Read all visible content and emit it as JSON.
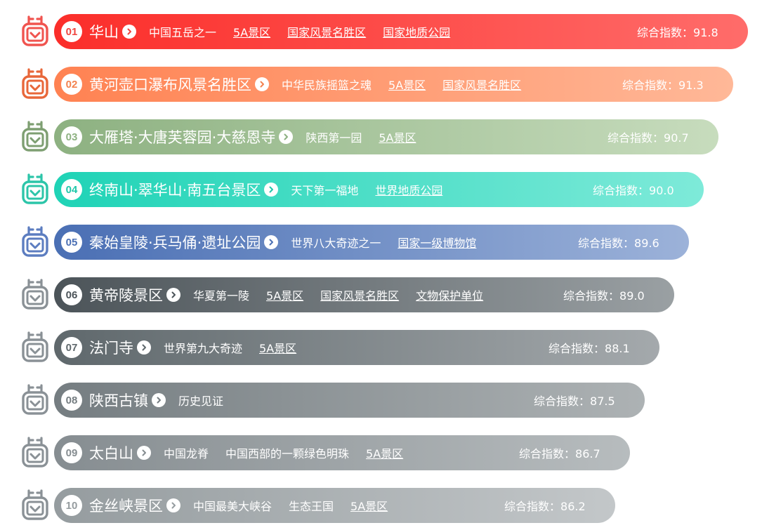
{
  "score_label": "综合指数：",
  "items": [
    {
      "rank": "01",
      "name": "华山",
      "score": "91.8",
      "tags": [
        {
          "text": "中国五岳之一",
          "link": false
        },
        {
          "text": "5A景区",
          "link": true
        },
        {
          "text": "国家风景名胜区",
          "link": true
        },
        {
          "text": "国家地质公园",
          "link": true
        }
      ],
      "colors": [
        "#fb2e2a",
        "#ff6c6a"
      ],
      "icon_color": "#f0544f",
      "rank_color": "#f0443f"
    },
    {
      "rank": "02",
      "name": "黄河壶口瀑布风景名胜区",
      "score": "91.3",
      "tags": [
        {
          "text": "中华民族摇篮之魂",
          "link": false
        },
        {
          "text": "5A景区",
          "link": true
        },
        {
          "text": "国家风景名胜区",
          "link": true
        }
      ],
      "colors": [
        "#ff8252",
        "#ffb898"
      ],
      "icon_color": "#e8673a",
      "rank_color": "#f3824f"
    },
    {
      "rank": "03",
      "name": "大雁塔·大唐芙蓉园·大慈恩寺",
      "score": "90.7",
      "tags": [
        {
          "text": "陕西第一园",
          "link": false
        },
        {
          "text": "5A景区",
          "link": true
        }
      ],
      "colors": [
        "#8db181",
        "#c7dcbd"
      ],
      "icon_color": "#7e9f72",
      "rank_color": "#8db181"
    },
    {
      "rank": "04",
      "name": "终南山·翠华山·南五台景区",
      "score": "90.0",
      "tags": [
        {
          "text": "天下第一福地",
          "link": false
        },
        {
          "text": "世界地质公园",
          "link": true
        }
      ],
      "colors": [
        "#1fd3b6",
        "#7eead9"
      ],
      "icon_color": "#2cc5a9",
      "rank_color": "#1fc7aa"
    },
    {
      "rank": "05",
      "name": "秦始皇陵·兵马俑·遗址公园",
      "score": "89.6",
      "tags": [
        {
          "text": "世界八大奇迹之一",
          "link": false
        },
        {
          "text": "国家一级博物馆",
          "link": true
        }
      ],
      "colors": [
        "#4a6fb4",
        "#9cb2d9"
      ],
      "icon_color": "#5c7dc0",
      "rank_color": "#4a6fb4"
    },
    {
      "rank": "06",
      "name": "黄帝陵景区",
      "score": "89.0",
      "tags": [
        {
          "text": "华夏第一陵",
          "link": false
        },
        {
          "text": "5A景区",
          "link": true
        },
        {
          "text": "国家风景名胜区",
          "link": true
        },
        {
          "text": "文物保护单位",
          "link": true
        }
      ],
      "colors": [
        "#4c5459",
        "#9aa0a3"
      ],
      "icon_color": "#8a9196",
      "rank_color": "#4c5459"
    },
    {
      "rank": "07",
      "name": "法门寺",
      "score": "88.1",
      "tags": [
        {
          "text": "世界第九大奇迹",
          "link": false
        },
        {
          "text": "5A景区",
          "link": true
        }
      ],
      "colors": [
        "#5f686c",
        "#a4a9ac"
      ],
      "icon_color": "#8a9196",
      "rank_color": "#5f686c"
    },
    {
      "rank": "08",
      "name": "陕西古镇",
      "score": "87.5",
      "tags": [
        {
          "text": "历史见证",
          "link": false
        }
      ],
      "colors": [
        "#757d81",
        "#adb2b4"
      ],
      "icon_color": "#8a9196",
      "rank_color": "#757d81"
    },
    {
      "rank": "09",
      "name": "太白山",
      "score": "86.7",
      "tags": [
        {
          "text": "中国龙脊",
          "link": false
        },
        {
          "text": "中国西部的一颗绿色明珠",
          "link": false
        },
        {
          "text": "5A景区",
          "link": true
        }
      ],
      "colors": [
        "#868d91",
        "#b7bcbe"
      ],
      "icon_color": "#8a9196",
      "rank_color": "#868d91"
    },
    {
      "rank": "10",
      "name": "金丝峡景区",
      "score": "86.2",
      "tags": [
        {
          "text": "中国最美大峡谷",
          "link": false
        },
        {
          "text": "生态王国",
          "link": false
        },
        {
          "text": "5A景区",
          "link": true
        }
      ],
      "colors": [
        "#959c9f",
        "#c3c7c9"
      ],
      "icon_color": "#8a9196",
      "rank_color": "#959c9f"
    }
  ]
}
